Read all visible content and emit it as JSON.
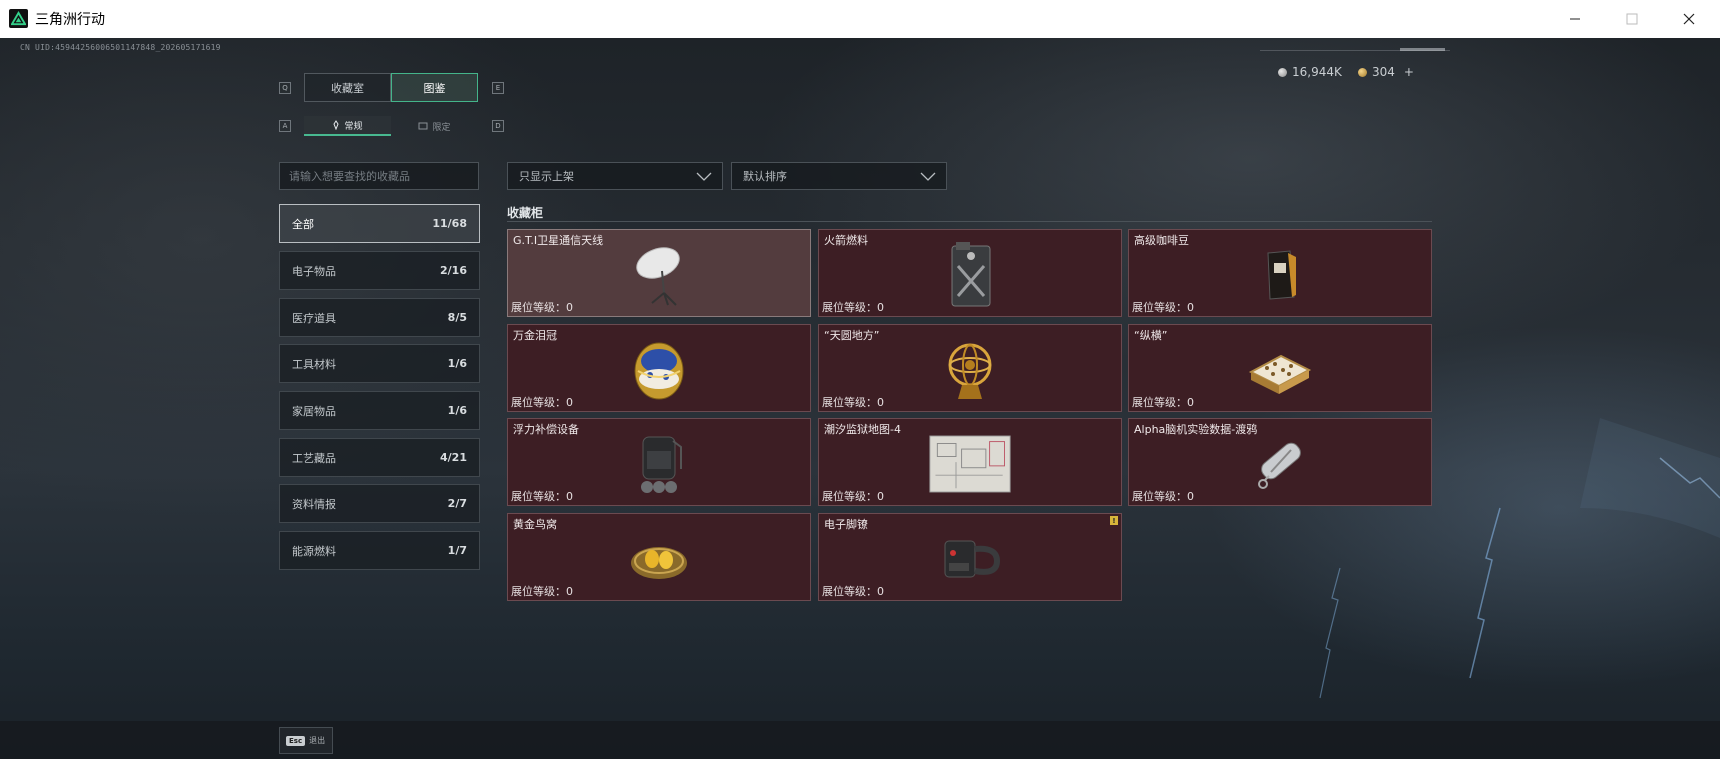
{
  "window": {
    "title": "三角洲行动"
  },
  "header": {
    "uid": "CN UID:4594425600650114784​8_202605171619",
    "currency_1": "16,944K",
    "currency_2": "304",
    "currency_2_plus": "+"
  },
  "tabs": {
    "key_left": "Q",
    "key_right": "E",
    "items": [
      {
        "label": "收藏室"
      },
      {
        "label": "图鉴"
      }
    ],
    "sub_key_left": "A",
    "sub_key_right": "D",
    "sub_items": [
      {
        "label": "常规"
      },
      {
        "label": "限定"
      }
    ]
  },
  "search": {
    "placeholder": "请输入想要查找的收藏品"
  },
  "filters": {
    "display_filter": "只显示上架",
    "sort": "默认排序"
  },
  "categories": [
    {
      "label": "全部",
      "count": "11/68"
    },
    {
      "label": "电子物品",
      "count": "2/16"
    },
    {
      "label": "医疗道具",
      "count": "8/5"
    },
    {
      "label": "工具材料",
      "count": "1/6"
    },
    {
      "label": "家居物品",
      "count": "1/6"
    },
    {
      "label": "工艺藏品",
      "count": "4/21"
    },
    {
      "label": "资料情报",
      "count": "2/7"
    },
    {
      "label": "能源燃料",
      "count": "1/7"
    }
  ],
  "cabinet": {
    "title": "收藏柜",
    "items": [
      {
        "name": "G.T.I卫星通信天线",
        "level": "展位等级：0",
        "icon": "satellite-dish-icon"
      },
      {
        "name": "火箭燃料",
        "level": "展位等级：0",
        "icon": "fuel-canister-icon"
      },
      {
        "name": "高级咖啡豆",
        "level": "展位等级：0",
        "icon": "coffee-bag-icon"
      },
      {
        "name": "万金泪冠",
        "level": "展位等级：0",
        "icon": "jeweled-egg-icon"
      },
      {
        "name": "“天圆地方”",
        "level": "展位等级：0",
        "icon": "armillary-sphere-icon"
      },
      {
        "name": "“纵横”",
        "level": "展位等级：0",
        "icon": "chess-board-icon"
      },
      {
        "name": "浮力补偿设备",
        "level": "展位等级：0",
        "icon": "buoyancy-device-icon"
      },
      {
        "name": "潮汐监狱地图-4",
        "level": "展位等级：0",
        "icon": "map-icon"
      },
      {
        "name": "Alpha脑机实验数据-渡鸦",
        "level": "展位等级：0",
        "icon": "data-capsule-icon"
      },
      {
        "name": "黄金鸟窝",
        "level": "展位等级：0",
        "icon": "gold-nest-icon"
      },
      {
        "name": "电子脚镣",
        "level": "展位等级：0",
        "icon": "ankle-monitor-icon",
        "warn": "!"
      }
    ]
  },
  "footer": {
    "esc_key": "Esc",
    "esc_label": "退出"
  }
}
